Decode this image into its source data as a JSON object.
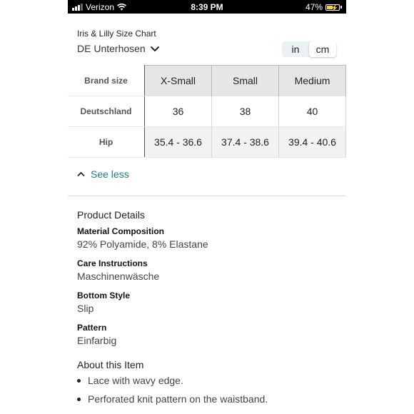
{
  "status_bar": {
    "carrier": "Verizon",
    "time": "8:39 PM",
    "battery": "47%",
    "battery_level": 0.47,
    "icons": [
      "signal-icon",
      "wifi-icon",
      "battery-charging-icon"
    ]
  },
  "size_chart": {
    "title": "Iris & Lilly Size Chart",
    "region_selector": "DE Unterhosen",
    "units": [
      "in",
      "cm"
    ],
    "selected_unit": "in",
    "row_header": "Brand size",
    "columns": [
      "X-Small",
      "Small",
      "Medium"
    ],
    "rows": [
      {
        "label": "Deutschland",
        "values": [
          "36",
          "38",
          "40"
        ]
      },
      {
        "label": "Hip",
        "values": [
          "35.4 - 36.6",
          "37.4 - 38.6",
          "39.4 - 40.6"
        ]
      }
    ],
    "see_less": "See less"
  },
  "product_details": {
    "heading": "Product Details",
    "attributes": [
      {
        "label": "Material Composition",
        "value": "92% Polyamide, 8% Elastane"
      },
      {
        "label": "Care Instructions",
        "value": "Maschinenwäsche"
      },
      {
        "label": "Bottom Style",
        "value": "Slip"
      },
      {
        "label": "Pattern",
        "value": "Einfarbig"
      }
    ]
  },
  "about": {
    "heading": "About this Item",
    "bullets": [
      "Lace with wavy edge.",
      "Perforated knit pattern on the waistband."
    ]
  },
  "colors": {
    "link": "#1a7a84",
    "header_bg": "#e6e6e6"
  }
}
